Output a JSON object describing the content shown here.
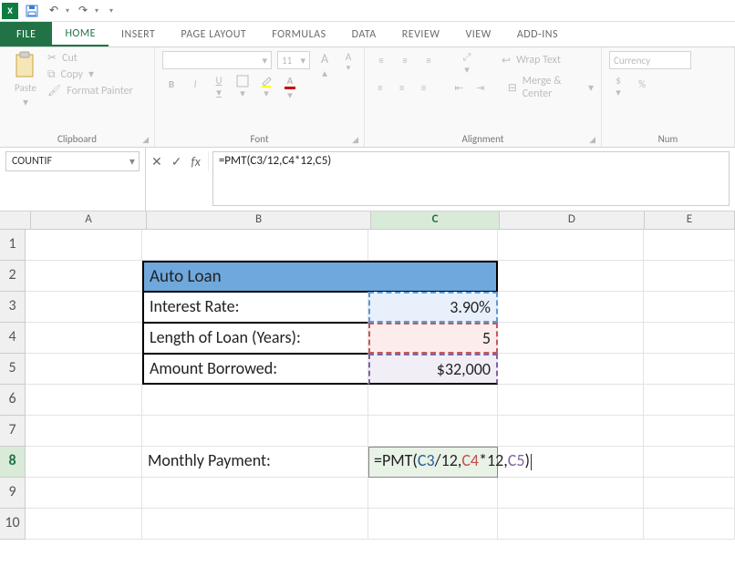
{
  "qat": {
    "app_short": "X"
  },
  "tabs": {
    "file": "FILE",
    "home": "HOME",
    "insert": "INSERT",
    "page_layout": "PAGE LAYOUT",
    "formulas": "FORMULAS",
    "data": "DATA",
    "review": "REVIEW",
    "view": "VIEW",
    "addins": "ADD-INS"
  },
  "ribbon": {
    "clipboard": {
      "paste": "Paste",
      "cut": "Cut",
      "copy": "Copy",
      "format_painter": "Format Painter",
      "group": "Clipboard"
    },
    "font": {
      "family": "",
      "size": "11",
      "aUp": "A",
      "aDn": "A",
      "b": "B",
      "i": "I",
      "u": "U",
      "group": "Font"
    },
    "alignment": {
      "wrap": "Wrap Text",
      "merge": "Merge & Center",
      "group": "Alignment"
    },
    "number": {
      "format": "Currency",
      "dollar": "$",
      "percent": "%",
      "group": "Num"
    }
  },
  "namebox": "COUNTIF",
  "formula": "=PMT(C3/12,C4*12,C5)",
  "cols": [
    "A",
    "B",
    "C",
    "D",
    "E"
  ],
  "rows": [
    "1",
    "2",
    "3",
    "4",
    "5",
    "6",
    "7",
    "8",
    "9",
    "10"
  ],
  "cells": {
    "b2": "Auto Loan",
    "b3": "Interest Rate:",
    "b4": "Length of Loan (Years):",
    "b5": "Amount Borrowed:",
    "b8": "Monthly Payment:",
    "c3": "3.90%",
    "c4": "5",
    "c5": "$32,000",
    "c8_prefix": "=PMT(",
    "c8_r1": "C3",
    "c8_mid1": "/12,",
    "c8_r2": "C4",
    "c8_mid2": "*12,",
    "c8_r3": "C5",
    "c8_suffix": ")"
  },
  "chart_data": {
    "type": "table",
    "title": "Auto Loan",
    "rows": [
      {
        "label": "Interest Rate:",
        "value": "3.90%"
      },
      {
        "label": "Length of Loan (Years):",
        "value": 5
      },
      {
        "label": "Amount Borrowed:",
        "value": "$32,000"
      }
    ],
    "formula_cell": {
      "label": "Monthly Payment:",
      "formula": "=PMT(C3/12,C4*12,C5)"
    }
  }
}
